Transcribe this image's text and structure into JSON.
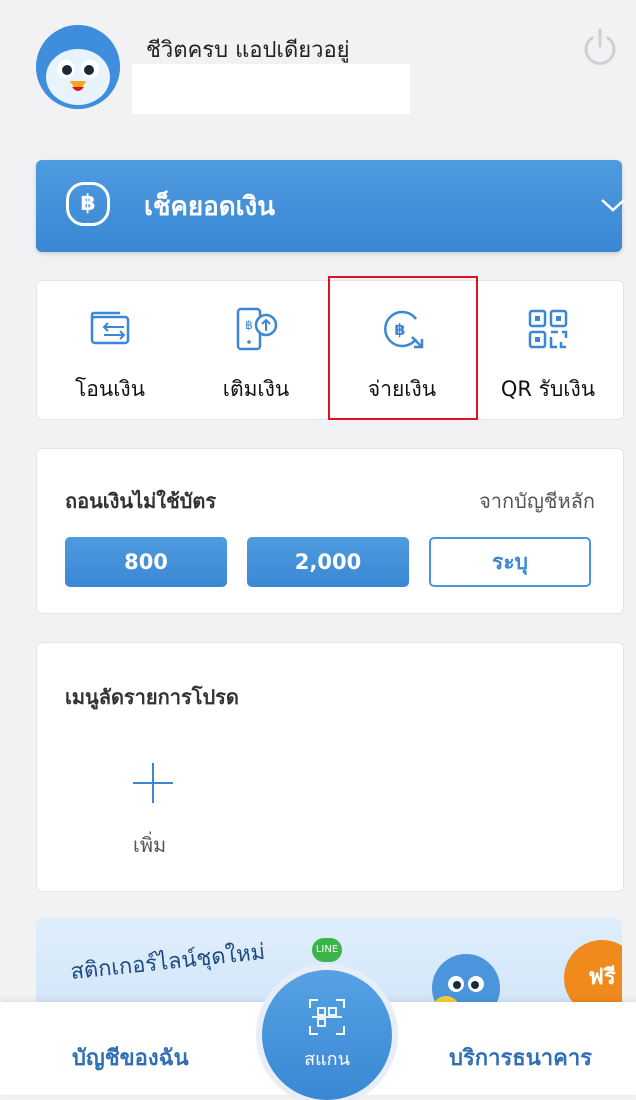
{
  "header": {
    "greeting": "ชีวิตครบ แอปเดียวอยู่",
    "power_icon": "power-icon",
    "avatar_icon": "bird-mascot-avatar"
  },
  "balance": {
    "label": "เช็คยอดเงิน",
    "icon": "baht-icon",
    "chevron": "chevron-down-icon"
  },
  "actions": [
    {
      "label": "โอนเงิน",
      "icon": "transfer-icon"
    },
    {
      "label": "เติมเงิน",
      "icon": "topup-icon"
    },
    {
      "label": "จ่ายเงิน",
      "icon": "pay-icon"
    },
    {
      "label": "QR รับเงิน",
      "icon": "qr-icon"
    }
  ],
  "withdraw": {
    "title": "ถอนเงินไม่ใช้บัตร",
    "subtitle": "จากบัญชีหลัก",
    "amounts": [
      "800",
      "2,000",
      "ระบุ"
    ]
  },
  "favorites": {
    "title": "เมนูลัดรายการโปรด",
    "add_label": "เพิ่ม"
  },
  "promo": {
    "text": "สติกเกอร์ไลน์ชุดใหม่",
    "line_badge": "LINE",
    "free_badge": "ฟรี"
  },
  "bottom_nav": {
    "left": "บัญชีของฉัน",
    "center": "สแกน",
    "right": "บริการธนาคาร"
  },
  "colors": {
    "primary": "#3a87d4",
    "highlight": "#e0141e"
  }
}
